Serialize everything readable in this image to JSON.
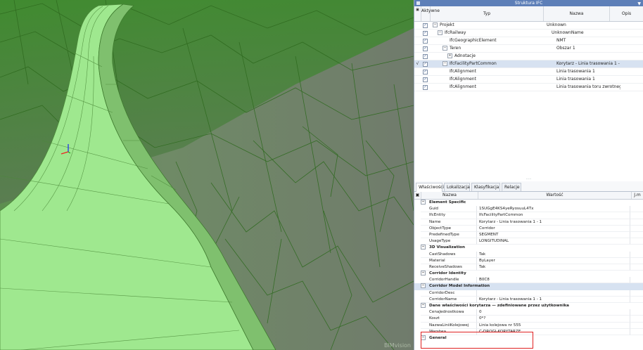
{
  "viewport": {
    "watermark": "BIMvision"
  },
  "ifc_panel": {
    "title": "Struktura IFC",
    "columns": {
      "visible": "Aktywne",
      "type": "Typ",
      "name": "Nazwa",
      "desc": "Opis"
    },
    "rows": [
      {
        "indent": 0,
        "toggle": "−",
        "type": "Projekt",
        "name": "Unknown",
        "checked": true,
        "selected": false
      },
      {
        "indent": 1,
        "toggle": "−",
        "type": "IfcRailway",
        "name": "UnknownName",
        "checked": true,
        "selected": false
      },
      {
        "indent": 2,
        "toggle": "",
        "type": "IfcGeographicElement",
        "name": "NMT",
        "checked": true,
        "selected": false
      },
      {
        "indent": 2,
        "toggle": "−",
        "type": "Teren",
        "name": "Obszar 1",
        "checked": true,
        "selected": false
      },
      {
        "indent": 3,
        "toggle": "+",
        "type": "Adnotacje",
        "name": "",
        "checked": true,
        "selected": false
      },
      {
        "indent": 2,
        "toggle": "−",
        "type": "IfcFacilityPartCommon",
        "name": "Korytarz - Linia trasowania 1 - 1",
        "checked": true,
        "selected": true
      },
      {
        "indent": 2,
        "toggle": "",
        "type": "IfcAlignment",
        "name": "Linia trasowania 1",
        "checked": true,
        "selected": false
      },
      {
        "indent": 2,
        "toggle": "",
        "type": "IfcAlignment",
        "name": "Linia trasowania 1",
        "checked": true,
        "selected": false
      },
      {
        "indent": 2,
        "toggle": "",
        "type": "IfcAlignment",
        "name": "Linia trasowania toru zwrotneg...",
        "checked": true,
        "selected": false
      }
    ],
    "splitter": "....."
  },
  "tabs": [
    "Właściwości",
    "Lokalizacja",
    "Klasyfikacja",
    "Relacje"
  ],
  "props_header": {
    "name": "Nazwa",
    "value": "Wartość",
    "unit": "J.m"
  },
  "property_groups": [
    {
      "title": "Element Specific",
      "highlighted": false,
      "rows": [
        {
          "k": "Guid",
          "v": "1SUGgE4KS4yeRyosuuL4Tx"
        },
        {
          "k": "IfcEntity",
          "v": "IfcFacilityPartCommon"
        },
        {
          "k": "Name",
          "v": "Korytarz - Linia trasowania 1 - 1"
        },
        {
          "k": "ObjectType",
          "v": "Corridor"
        },
        {
          "k": "PredefinedType",
          "v": "SEGMENT"
        },
        {
          "k": "UsageType",
          "v": "LONGITUDINAL"
        }
      ]
    },
    {
      "title": "3D Visualization",
      "highlighted": false,
      "rows": [
        {
          "k": "CastShadows",
          "v": "Tak"
        },
        {
          "k": "Material",
          "v": "ByLayer"
        },
        {
          "k": "ReceiveShadows",
          "v": "Tak"
        }
      ]
    },
    {
      "title": "Corridor Identity",
      "highlighted": false,
      "rows": [
        {
          "k": "CorridorHandle",
          "v": "B0C8"
        }
      ]
    },
    {
      "title": "Corridor Model Information",
      "highlighted": true,
      "rows": [
        {
          "k": "CorridorDesc",
          "v": ""
        },
        {
          "k": "CorridorName",
          "v": "Korytarz - Linia trasowania 1 - 1"
        }
      ]
    },
    {
      "title": "Dane właściwości korytarza — zdefiniowane przez użytkownika",
      "highlighted": false,
      "rows": [
        {
          "k": "CenaJednostkowa",
          "v": "0"
        },
        {
          "k": "Koszt",
          "v": "0*?"
        },
        {
          "k": "NazwaLiniiKolejowej",
          "v": "Linia kolejowa nr 555"
        },
        {
          "k": "Warstwa",
          "v": "C-DROGI-KORYTARZE"
        }
      ]
    },
    {
      "title": "General",
      "highlighted": false,
      "rows": []
    }
  ]
}
